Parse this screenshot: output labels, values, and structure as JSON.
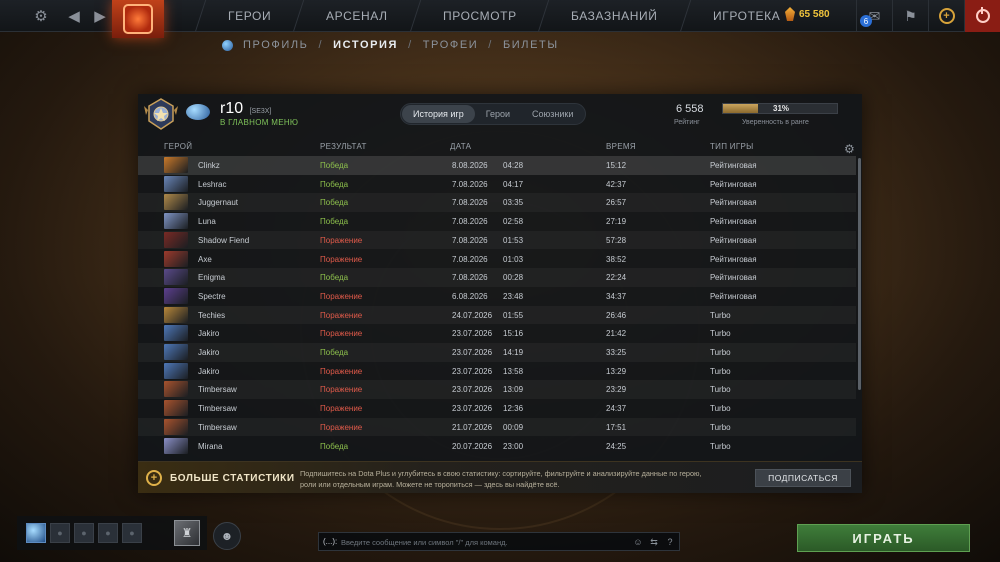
{
  "topbar": {
    "nav": [
      "ГЕРОИ",
      "АРСЕНАЛ",
      "ПРОСМОТР",
      "БАЗАЗНАНИЙ",
      "ИГРОТЕКА"
    ],
    "shards": "65 580",
    "notification_count": "6"
  },
  "subnav": [
    "ПРОФИЛЬ",
    "ИСТОРИЯ",
    "ТРОФЕИ",
    "БИЛЕТЫ"
  ],
  "profile": {
    "name": "r10",
    "tag": "[SE3X]",
    "status": "В ГЛАВНОМ МЕНЮ",
    "tabs": [
      "История игр",
      "Герои",
      "Союзники"
    ],
    "rating": "6 558",
    "rating_label": "Рейтинг",
    "confidence": 31,
    "confidence_text": "31%",
    "confidence_label": "Уверенность в ранге"
  },
  "columns": {
    "hero": "ГЕРОЙ",
    "result": "РЕЗУЛЬТАТ",
    "date": "ДАТА",
    "duration": "ВРЕМЯ",
    "type": "ТИП ИГРЫ"
  },
  "matches": [
    {
      "hero": "Clinkz",
      "result": "Победа",
      "win": true,
      "date": "8.08.2026",
      "time": "04:28",
      "duration": "15:12",
      "type": "Рейтинговая",
      "color": "#c9792a"
    },
    {
      "hero": "Leshrac",
      "result": "Победа",
      "win": true,
      "date": "7.08.2026",
      "time": "04:17",
      "duration": "42:37",
      "type": "Рейтинговая",
      "color": "#6a86b8"
    },
    {
      "hero": "Juggernaut",
      "result": "Победа",
      "win": true,
      "date": "7.08.2026",
      "time": "03:35",
      "duration": "26:57",
      "type": "Рейтинговая",
      "color": "#b08a4a"
    },
    {
      "hero": "Luna",
      "result": "Победа",
      "win": true,
      "date": "7.08.2026",
      "time": "02:58",
      "duration": "27:19",
      "type": "Рейтинговая",
      "color": "#7f94c4"
    },
    {
      "hero": "Shadow Fiend",
      "result": "Поражение",
      "win": false,
      "date": "7.08.2026",
      "time": "01:53",
      "duration": "57:28",
      "type": "Рейтинговая",
      "color": "#7a2a24"
    },
    {
      "hero": "Axe",
      "result": "Поражение",
      "win": false,
      "date": "7.08.2026",
      "time": "01:03",
      "duration": "38:52",
      "type": "Рейтинговая",
      "color": "#9c3a2c"
    },
    {
      "hero": "Enigma",
      "result": "Победа",
      "win": true,
      "date": "7.08.2026",
      "time": "00:28",
      "duration": "22:24",
      "type": "Рейтинговая",
      "color": "#5a4a8a"
    },
    {
      "hero": "Spectre",
      "result": "Поражение",
      "win": false,
      "date": "6.08.2026",
      "time": "23:48",
      "duration": "34:37",
      "type": "Рейтинговая",
      "color": "#5c3f8e"
    },
    {
      "hero": "Techies",
      "result": "Поражение",
      "win": false,
      "date": "24.07.2026",
      "time": "01:55",
      "duration": "26:46",
      "type": "Turbo",
      "color": "#b7873a"
    },
    {
      "hero": "Jakiro",
      "result": "Поражение",
      "win": false,
      "date": "23.07.2026",
      "time": "15:16",
      "duration": "21:42",
      "type": "Turbo",
      "color": "#4e78b8"
    },
    {
      "hero": "Jakiro",
      "result": "Победа",
      "win": true,
      "date": "23.07.2026",
      "time": "14:19",
      "duration": "33:25",
      "type": "Turbo",
      "color": "#4e78b8"
    },
    {
      "hero": "Jakiro",
      "result": "Поражение",
      "win": false,
      "date": "23.07.2026",
      "time": "13:58",
      "duration": "13:29",
      "type": "Turbo",
      "color": "#4e78b8"
    },
    {
      "hero": "Timbersaw",
      "result": "Поражение",
      "win": false,
      "date": "23.07.2026",
      "time": "13:09",
      "duration": "23:29",
      "type": "Turbo",
      "color": "#a8532e"
    },
    {
      "hero": "Timbersaw",
      "result": "Поражение",
      "win": false,
      "date": "23.07.2026",
      "time": "12:36",
      "duration": "24:37",
      "type": "Turbo",
      "color": "#a8532e"
    },
    {
      "hero": "Timbersaw",
      "result": "Поражение",
      "win": false,
      "date": "21.07.2026",
      "time": "00:09",
      "duration": "17:51",
      "type": "Turbo",
      "color": "#a8532e"
    },
    {
      "hero": "Mirana",
      "result": "Победа",
      "win": true,
      "date": "20.07.2026",
      "time": "23:00",
      "duration": "24:25",
      "type": "Turbo",
      "color": "#8a8fc6"
    }
  ],
  "promo": {
    "title": "БОЛЬШЕ СТАТИСТИКИ",
    "text": "Подпишитесь на Dota Plus и углубитесь в свою статистику: сортируйте, фильтруйте и анализируйте данные по герою, роли или отдельным играм. Можете не торопиться — здесь вы найдёте всё.",
    "button": "ПОДПИСАТЬСЯ"
  },
  "chat": {
    "prefix": "(...):",
    "placeholder": "Введите сообщение или символ \"/\" для команд."
  },
  "play_button": "ИГРАТЬ",
  "colors": {
    "win": "#8dc04c",
    "loss": "#e05a4a",
    "play": "#3f7d3a"
  }
}
